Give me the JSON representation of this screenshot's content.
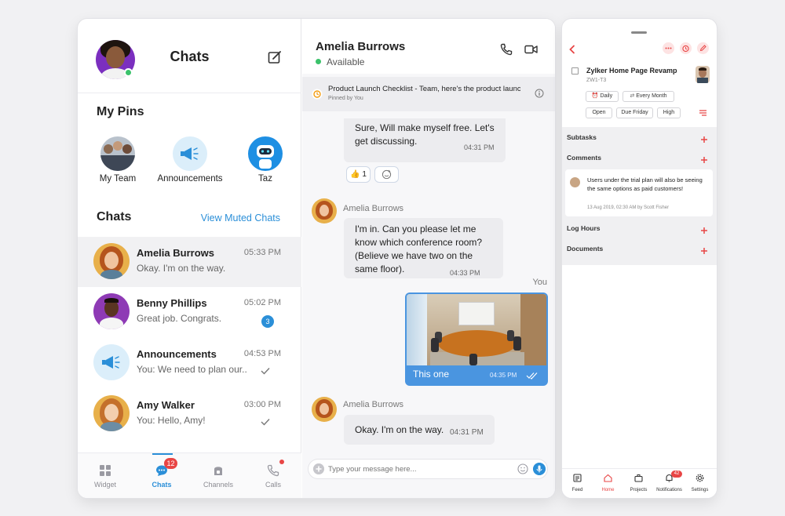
{
  "left": {
    "title": "Chats",
    "pins_title": "My Pins",
    "pins": [
      {
        "label": "My Team"
      },
      {
        "label": "Announcements"
      },
      {
        "label": "Taz"
      }
    ],
    "chats_title": "Chats",
    "muted_link": "View Muted Chats",
    "chats": [
      {
        "name": "Amelia Burrows",
        "msg": "Okay. I'm on the way.",
        "time": "05:33 PM"
      },
      {
        "name": "Benny Phillips",
        "msg": "Great job. Congrats.",
        "time": "05:02 PM",
        "badge": "3"
      },
      {
        "name": "Announcements",
        "msg": "You: We need to plan our..",
        "time": "04:53 PM"
      },
      {
        "name": "Amy Walker",
        "msg": "You: Hello, Amy!",
        "time": "03:00 PM"
      }
    ],
    "tabs": [
      {
        "label": "Widget"
      },
      {
        "label": "Chats",
        "badge": "12"
      },
      {
        "label": "Channels"
      },
      {
        "label": "Calls"
      }
    ]
  },
  "center": {
    "contact_name": "Amelia Burrows",
    "status": "Available",
    "pinned": {
      "text": "Product Launch Checklist - Team, here's the product launch c...",
      "by": "Pinned by You"
    },
    "messages": {
      "m1": {
        "text": "Sure, Will make myself free. Let's get discussing.",
        "time": "04:31 PM"
      },
      "reaction_count": "1",
      "sender2": "Amelia Burrows",
      "m2": {
        "text": "I'm in. Can you please let me know which conference room? (Believe we have two on the same floor).",
        "time": "04:33 PM"
      },
      "you_label": "You",
      "img": {
        "caption": "This one",
        "time": "04:35 PM"
      },
      "sender3": "Amelia Burrows",
      "m3": {
        "text": "Okay. I'm on the way.",
        "time": "04:31 PM"
      }
    },
    "input_placeholder": "Type your message here..."
  },
  "phone": {
    "task": {
      "title": "Zylker Home Page Revamp",
      "id": "ZW1-T3",
      "chips_row1": [
        "Daily",
        "Every Month"
      ],
      "chips_row2": [
        "Open",
        "Due Friday",
        "High"
      ]
    },
    "sections": {
      "subtasks": "Subtasks",
      "comments": "Comments",
      "log_hours": "Log Hours",
      "documents": "Documents"
    },
    "comment": {
      "text": "Users under the trial plan will also be seeing the same options as paid customers!",
      "meta": "13 Aug 2019, 02:30 AM by Scott Fisher"
    },
    "nav": [
      {
        "label": "Feed"
      },
      {
        "label": "Home"
      },
      {
        "label": "Projects"
      },
      {
        "label": "Notifications",
        "badge": "42"
      },
      {
        "label": "Settings"
      }
    ]
  },
  "colors": {
    "accent": "#2b8fd8",
    "online": "#3bc26b",
    "alert": "#e84545"
  }
}
